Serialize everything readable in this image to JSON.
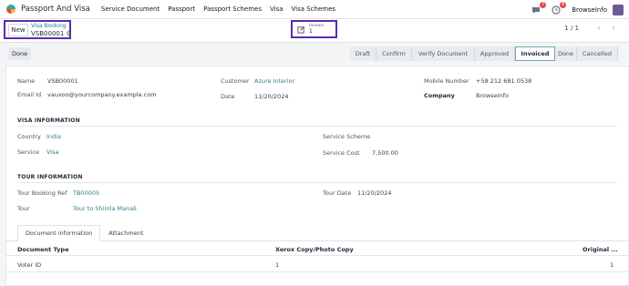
{
  "nav": {
    "app_name": "Passport And Visa",
    "menu": [
      "Service Document",
      "Passport",
      "Passport Schemes",
      "Visa",
      "Visa Schemes"
    ],
    "chat_badge": "7",
    "activity_badge": "8",
    "company": "BrowseInfo"
  },
  "control": {
    "new_label": "New",
    "breadcrumb_parent": "Visa Booking",
    "breadcrumb_current": "VSB00001",
    "smart_button_label": "Invoice",
    "smart_button_value": "1",
    "pager": "1 / 1"
  },
  "status": {
    "done_label": "Done",
    "stages": [
      {
        "label": "Draft",
        "active": false
      },
      {
        "label": "Confirm",
        "active": false
      },
      {
        "label": "Verify Document",
        "active": false
      },
      {
        "label": "Approved",
        "active": false
      },
      {
        "label": "Invoiced",
        "active": true
      },
      {
        "label": "Done",
        "active": false
      },
      {
        "label": "Cancelled",
        "active": false
      }
    ]
  },
  "form": {
    "name_label": "Name",
    "name_value": "VSB00001",
    "email_label": "Email Id",
    "email_value": "vauxoo@yourcompany.example.com",
    "customer_label": "Customer",
    "customer_value": "Azure Interior",
    "date_label": "Date",
    "date_value": "11/20/2024",
    "mobile_label": "Mobile Number",
    "mobile_value": "+58 212 681 0538",
    "company_label": "Company",
    "company_value": "BrowseInfo"
  },
  "visa": {
    "section_title": "VISA INFORMATION",
    "country_label": "Country",
    "country_value": "India",
    "service_label": "Service",
    "service_value": "Visa",
    "scheme_label": "Service Scheme",
    "scheme_value": "",
    "cost_label": "Service Cost",
    "cost_value": "7,500.00"
  },
  "tour": {
    "section_title": "TOUR INFORMATION",
    "ref_label": "Tour Booking Ref",
    "ref_value": "TB00005",
    "tour_label": "Tour",
    "tour_value": "Tour to Shimla Manali",
    "date_label": "Tour Date",
    "date_value": "11/20/2024"
  },
  "tabs": [
    "Document information",
    "Attachment"
  ],
  "table": {
    "headers": [
      "Document Type",
      "Xerox Copy/Photo Copy",
      "Original ..."
    ],
    "rows": [
      [
        "Voter ID",
        "1",
        "1"
      ]
    ]
  }
}
